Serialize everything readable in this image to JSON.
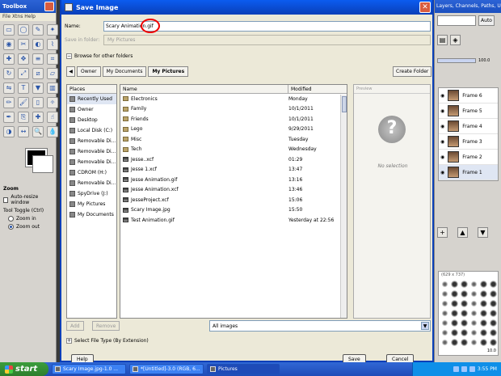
{
  "toolbox": {
    "title": "Toolbox",
    "menu": "File  Xtns  Help",
    "tool_icons": [
      "rect-select-icon",
      "ellipse-select-icon",
      "free-select-icon",
      "fuzzy-select-icon",
      "color-select-icon",
      "scissors-icon",
      "foreground-select-icon",
      "paths-icon",
      "color-picker-icon",
      "move-icon",
      "align-icon",
      "crop-icon",
      "rotate-icon",
      "scale-icon",
      "shear-icon",
      "perspective-icon",
      "flip-icon",
      "text-icon",
      "bucket-fill-icon",
      "blend-icon",
      "pencil-icon",
      "paintbrush-icon",
      "eraser-icon",
      "airbrush-icon",
      "ink-icon",
      "clone-icon",
      "heal-icon",
      "smudge-icon",
      "dodge-icon",
      "measure-icon",
      "magnify-icon",
      "convolve-icon"
    ],
    "options_title": "Zoom",
    "auto_resize": "Auto-resize window",
    "tool_toggle": "Tool Toggle  (Ctrl)",
    "zoom_in": "Zoom in",
    "zoom_out": "Zoom out"
  },
  "dock": {
    "title": "Layers, Channels, Paths, Undo",
    "auto_label": "Auto",
    "opacity": "100.0",
    "layers": [
      "Frame 6",
      "Frame 5",
      "Frame 4",
      "Frame 3",
      "Frame 2",
      "Frame 1"
    ],
    "brush_caption": "(629 x 737)",
    "brush_size": "10.0"
  },
  "dialog": {
    "title": "Save Image",
    "name_label": "Name:",
    "name_value": "Scary Animation.gif",
    "save_in_label": "Save in folder:",
    "save_in_value": "My Pictures",
    "browse_label": "Browse for other folders",
    "path": [
      "Owner",
      "My Documents",
      "My Pictures"
    ],
    "create_folder": "Create Folder",
    "places_header": "Places",
    "places": [
      "Recently Used",
      "Owner",
      "Desktop",
      "Local Disk (C:)",
      "Removable Di...",
      "Removable Di...",
      "Removable Di...",
      "CDROM (H:)",
      "Removable Di...",
      "SpyDrive (J:)",
      "My Pictures",
      "My Documents"
    ],
    "col_name": "Name",
    "col_modified": "Modified",
    "files": [
      {
        "name": "Electronics",
        "modified": "Monday",
        "kind": "folder"
      },
      {
        "name": "Family",
        "modified": "10/1/2011",
        "kind": "folder"
      },
      {
        "name": "Friends",
        "modified": "10/1/2011",
        "kind": "folder"
      },
      {
        "name": "Lego",
        "modified": "9/29/2011",
        "kind": "folder"
      },
      {
        "name": "Misc",
        "modified": "Tuesday",
        "kind": "folder"
      },
      {
        "name": "Tech",
        "modified": "Wednesday",
        "kind": "folder"
      },
      {
        "name": "Jesse..xcf",
        "modified": "01:29",
        "kind": "image"
      },
      {
        "name": "Jesse 1.xcf",
        "modified": "13:47",
        "kind": "image"
      },
      {
        "name": "Jesse Animation.gif",
        "modified": "13:16",
        "kind": "image"
      },
      {
        "name": "Jesse Animation.xcf",
        "modified": "13:46",
        "kind": "image"
      },
      {
        "name": "JesseProject.xcf",
        "modified": "15:06",
        "kind": "image"
      },
      {
        "name": "Scary Image.jpg",
        "modified": "15:50",
        "kind": "image"
      },
      {
        "name": "Test Animation.gif",
        "modified": "Yesterday at 22:56",
        "kind": "image"
      }
    ],
    "preview_header": "Preview",
    "no_selection": "No selection",
    "add_label": "Add",
    "remove_label": "Remove",
    "filter_value": "All images",
    "select_type": "Select File Type (By Extension)",
    "help_label": "Help",
    "save_label": "Save",
    "cancel_label": "Cancel"
  },
  "taskbar": {
    "start": "start",
    "tasks": [
      "Scary Image.jpg-1.0 ...",
      "*[Untitled]-3.0 (RGB, 6...",
      "Pictures"
    ],
    "clock": "3:55 PM"
  }
}
